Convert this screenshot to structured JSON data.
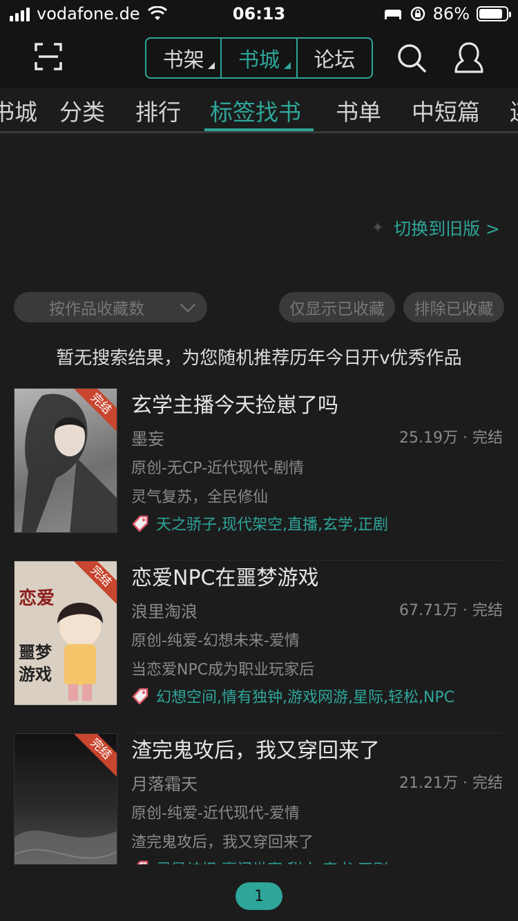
{
  "status_bar": {
    "carrier": "vodafone.de",
    "time": "06:13",
    "battery": "86%",
    "battery_level": 0.86
  },
  "header": {
    "segments": [
      {
        "label": "书架",
        "active": false
      },
      {
        "label": "书城",
        "active": true
      },
      {
        "label": "论坛",
        "active": false
      }
    ],
    "icons": [
      "scan-icon",
      "search-icon",
      "user-icon"
    ]
  },
  "tabs": [
    {
      "label": "书城"
    },
    {
      "label": "分类"
    },
    {
      "label": "排行"
    },
    {
      "label": "标签找书",
      "active": true
    },
    {
      "label": "书单"
    },
    {
      "label": "中短篇"
    },
    {
      "label": "连"
    }
  ],
  "switch_old": "切换到旧版 >",
  "filters": {
    "sort": "按作品收藏数",
    "only_collected": "仅显示已收藏",
    "exclude_collected": "排除已收藏"
  },
  "notice": "暂无搜索结果，为您随机推荐历年今日开v优秀作品",
  "books": [
    {
      "title": "玄学主播今天捡崽了吗",
      "author": "墨妄",
      "stats": "25.19万 · 完结",
      "genre": "原创-无CP-近代现代-剧情",
      "intro": "灵气复苏，全民修仙",
      "tags": "天之骄子,现代架空,直播,玄学,正剧",
      "cover_badge": "完结",
      "cover_bg": "#9a9a9a"
    },
    {
      "title": "恋爱NPC在噩梦游戏",
      "author": "浪里淘浪",
      "stats": "67.71万 · 完结",
      "genre": "原创-纯爱-幻想未来-爱情",
      "intro": "当恋爱NPC成为职业玩家后",
      "tags": "幻想空间,情有独钟,游戏网游,星际,轻松,NPC",
      "cover_badge": "完结",
      "cover_bg": "#d9cfc2"
    },
    {
      "title": "渣完鬼攻后，我又穿回来了",
      "author": "月落霜天",
      "stats": "21.21万 · 完结",
      "genre": "原创-纯爱-近代现代-爱情",
      "intro": "渣完鬼攻后，我又穿回来了",
      "tags": "灵异神怪,豪门世家,甜文,穿书,正剧",
      "cover_badge": "完结",
      "cover_bg": "#2a2a2a"
    }
  ],
  "pager": {
    "current": "1"
  },
  "colors": {
    "accent": "#2ea69a",
    "background": "#1c1c1c",
    "header": "#141414"
  }
}
